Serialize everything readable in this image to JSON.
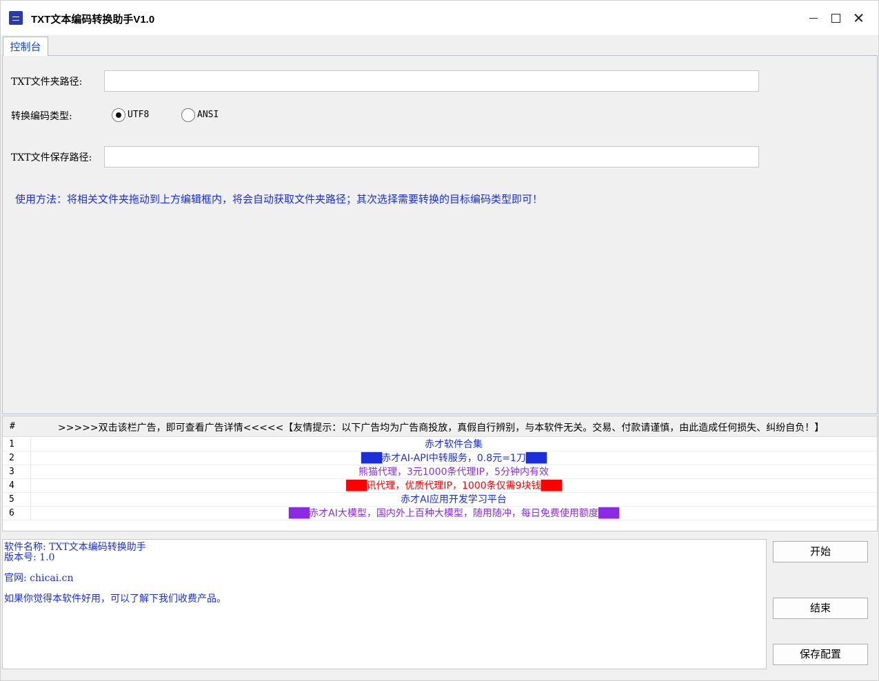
{
  "window": {
    "title": "TXT文本编码转换助手V1.0"
  },
  "tabs": [
    {
      "label": "控制台"
    }
  ],
  "form": {
    "folder_label": "TXT文件夹路径:",
    "folder_value": "",
    "encoding_label": "转换编码类型:",
    "encoding_options": [
      {
        "label": "UTF8",
        "checked": true
      },
      {
        "label": "ANSI",
        "checked": false
      }
    ],
    "save_label": "TXT文件保存路径:",
    "save_value": "",
    "usage": "使用方法：将相关文件夹拖动到上方编辑框内，将会自动获取文件夹路径；其次选择需要转换的目标编码类型即可！"
  },
  "ads": {
    "col_num": "#",
    "col_title": ">>>>>双击该栏广告，即可查看广告详情<<<<<【友情提示：以下广告均为广告商投放，真假自行辨别，与本软件无关。交易、付款请谨慎，由此造成任何损失、纠纷自负！】",
    "rows": [
      {
        "num": "1",
        "text": "赤才软件合集",
        "color": "#1a2fd8",
        "block_color": ""
      },
      {
        "num": "2",
        "text": "赤才AI-API中转服务，0.8元=1刀",
        "color": "#1a2fd8",
        "block_color": "#1a2fd8"
      },
      {
        "num": "3",
        "text": "熊猫代理，3元1000条代理IP，5分钟内有效",
        "color": "#8a2be2",
        "block_color": ""
      },
      {
        "num": "4",
        "text": "讯代理，优质代理IP，1000条仅需9块钱",
        "color": "#ff0000",
        "block_color": "#ff0000"
      },
      {
        "num": "5",
        "text": "赤才AI应用开发学习平台",
        "color": "#1a2fd8",
        "block_color": ""
      },
      {
        "num": "6",
        "text": "赤才AI大模型，国内外上百种大模型，随用随冲，每日免费使用额度",
        "color": "#8a2be2",
        "block_color": "#8a2be2"
      }
    ]
  },
  "info": {
    "name": "软件名称: TXT文本编码转换助手",
    "version": "版本号: 1.0",
    "website": "官网: chicai.cn",
    "note": "如果你觉得本软件好用，可以了解下我们收费产品。"
  },
  "buttons": {
    "start": "开始",
    "end": "结束",
    "save_config": "保存配置"
  }
}
